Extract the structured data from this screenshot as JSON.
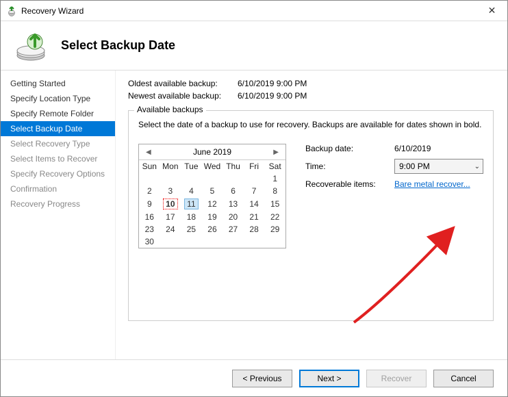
{
  "window": {
    "title": "Recovery Wizard",
    "close_glyph": "✕"
  },
  "header": {
    "title": "Select Backup Date"
  },
  "sidebar": {
    "steps": [
      {
        "label": "Getting Started",
        "state": "past"
      },
      {
        "label": "Specify Location Type",
        "state": "past"
      },
      {
        "label": "Specify Remote Folder",
        "state": "past"
      },
      {
        "label": "Select Backup Date",
        "state": "active"
      },
      {
        "label": "Select Recovery Type",
        "state": "future"
      },
      {
        "label": "Select Items to Recover",
        "state": "future"
      },
      {
        "label": "Specify Recovery Options",
        "state": "future"
      },
      {
        "label": "Confirmation",
        "state": "future"
      },
      {
        "label": "Recovery Progress",
        "state": "future"
      }
    ]
  },
  "meta": {
    "oldest_label": "Oldest available backup:",
    "oldest_value": "6/10/2019 9:00 PM",
    "newest_label": "Newest available backup:",
    "newest_value": "6/10/2019 9:00 PM"
  },
  "group": {
    "title": "Available backups",
    "desc": "Select the date of a backup to use for recovery. Backups are available for dates shown in bold."
  },
  "calendar": {
    "month": "June 2019",
    "prev_glyph": "◀",
    "next_glyph": "▶",
    "dow": [
      "Sun",
      "Mon",
      "Tue",
      "Wed",
      "Thu",
      "Fri",
      "Sat"
    ],
    "weeks": [
      [
        "",
        "",
        "",
        "",
        "",
        "",
        "1"
      ],
      [
        "2",
        "3",
        "4",
        "5",
        "6",
        "7",
        "8"
      ],
      [
        "9",
        "10",
        "11",
        "12",
        "13",
        "14",
        "15"
      ],
      [
        "16",
        "17",
        "18",
        "19",
        "20",
        "21",
        "22"
      ],
      [
        "23",
        "24",
        "25",
        "26",
        "27",
        "28",
        "29"
      ],
      [
        "30",
        "",
        "",
        "",
        "",
        "",
        ""
      ]
    ],
    "bold_cells": [
      "10"
    ],
    "today_cell": "10",
    "hover_cell": "11"
  },
  "details": {
    "backup_date_label": "Backup date:",
    "backup_date_value": "6/10/2019",
    "time_label": "Time:",
    "time_value": "9:00 PM",
    "recoverable_label": "Recoverable items:",
    "recoverable_link": "Bare metal recover..."
  },
  "footer": {
    "previous": "< Previous",
    "next": "Next >",
    "recover": "Recover",
    "cancel": "Cancel"
  }
}
